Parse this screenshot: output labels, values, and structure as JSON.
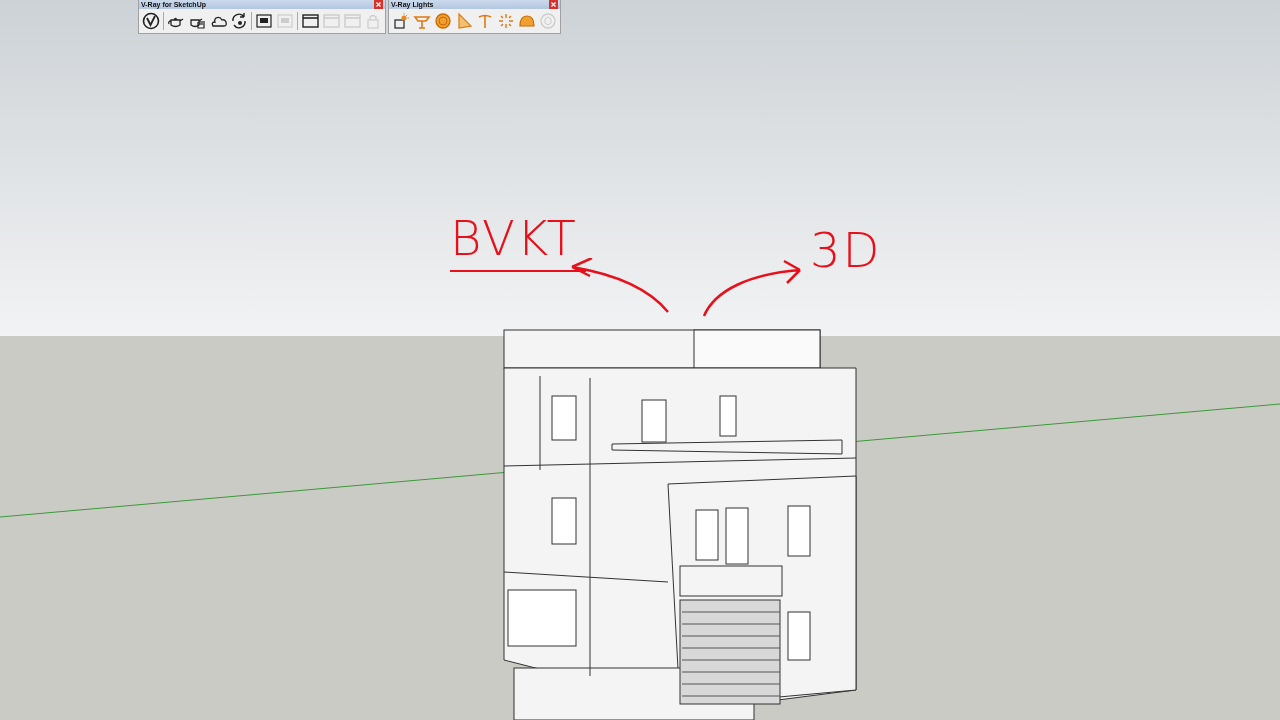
{
  "toolbars": [
    {
      "title": "V-Ray for SketchUp",
      "icons": [
        {
          "kind": "vray-logo",
          "disabled": false
        },
        {
          "kind": "sep"
        },
        {
          "kind": "teapot",
          "disabled": false
        },
        {
          "kind": "teapot-hand",
          "disabled": false
        },
        {
          "kind": "cloud",
          "disabled": false
        },
        {
          "kind": "refresh",
          "disabled": false
        },
        {
          "kind": "sep"
        },
        {
          "kind": "frame-buffer",
          "disabled": false
        },
        {
          "kind": "frame-buffer",
          "disabled": true
        },
        {
          "kind": "sep"
        },
        {
          "kind": "window",
          "disabled": false
        },
        {
          "kind": "window",
          "disabled": true
        },
        {
          "kind": "window",
          "disabled": true
        },
        {
          "kind": "lock",
          "disabled": true
        }
      ]
    },
    {
      "title": "V-Ray Lights",
      "icons": [
        {
          "kind": "light-gen",
          "disabled": false
        },
        {
          "kind": "rect-light",
          "disabled": false
        },
        {
          "kind": "sphere-light",
          "disabled": false
        },
        {
          "kind": "spot-light",
          "disabled": false
        },
        {
          "kind": "ies-light",
          "disabled": false
        },
        {
          "kind": "omni-light",
          "disabled": false
        },
        {
          "kind": "dome-light",
          "disabled": false
        },
        {
          "kind": "mesh-light",
          "disabled": true
        }
      ]
    }
  ],
  "annotations": [
    {
      "text": "BVKT",
      "underlined": true
    },
    {
      "text": "3D",
      "underlined": false
    }
  ]
}
